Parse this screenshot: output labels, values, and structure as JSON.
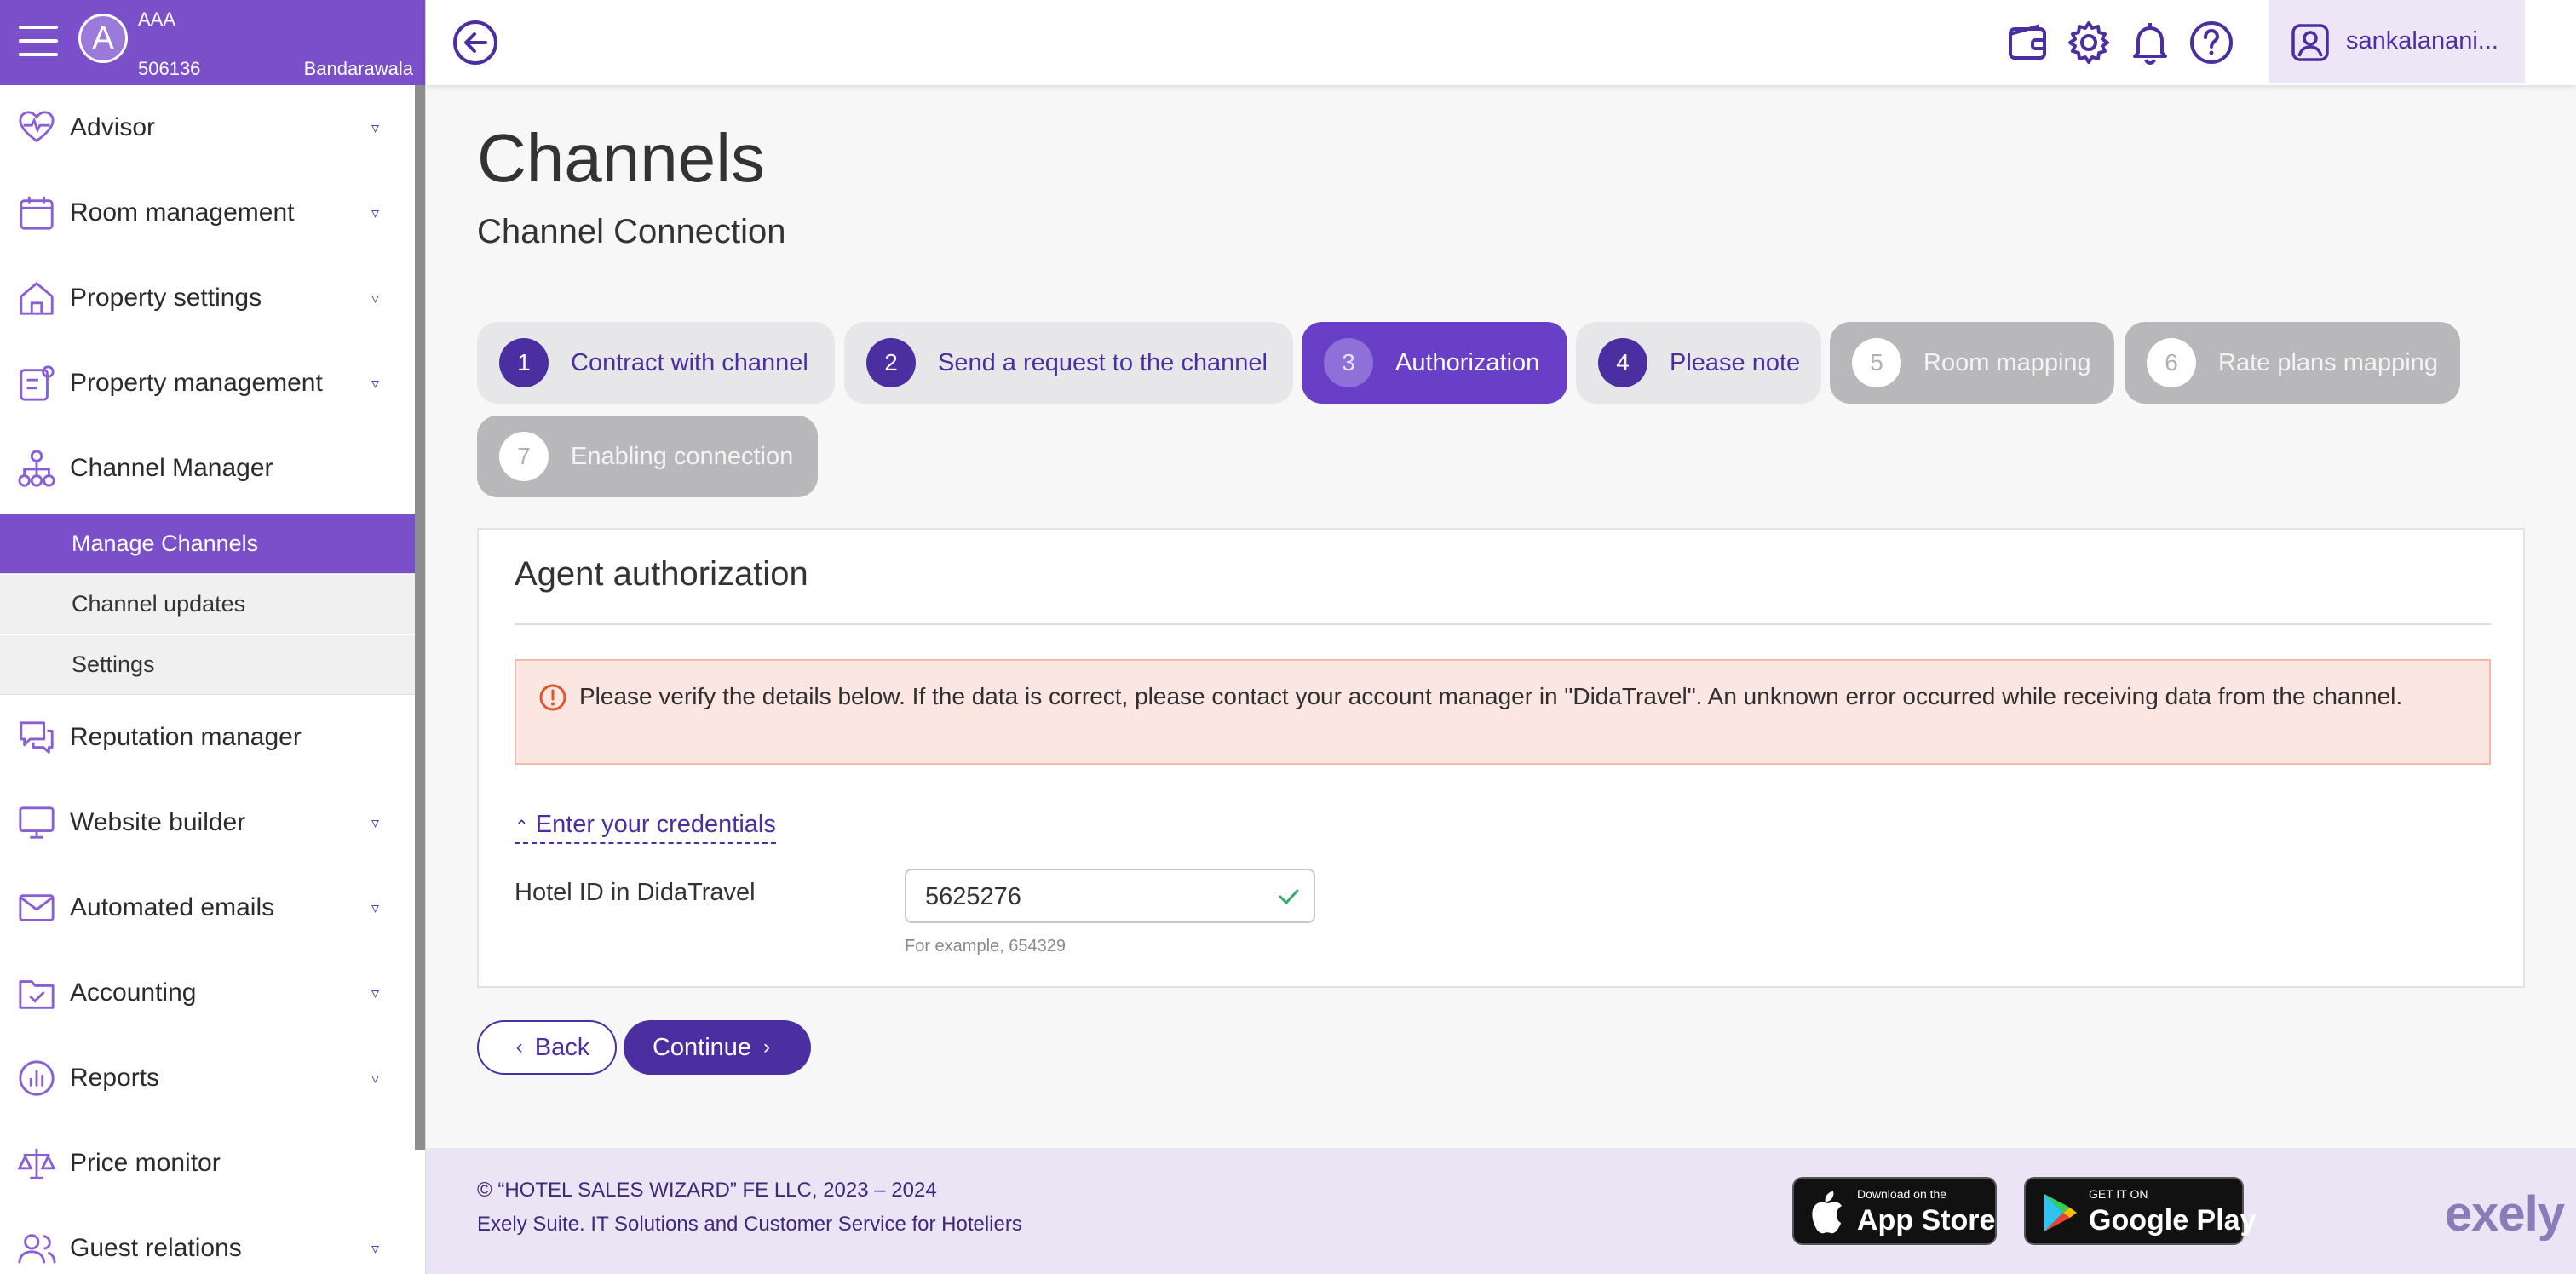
{
  "sidebar": {
    "org_initial": "A",
    "org_name": "AAA",
    "org_id": "506136",
    "location": "Bandarawala",
    "items": [
      {
        "label": "Advisor",
        "icon": "heart-pulse-icon"
      },
      {
        "label": "Room management",
        "icon": "calendar-icon"
      },
      {
        "label": "Property settings",
        "icon": "home-icon"
      },
      {
        "label": "Property management",
        "icon": "clipboard-icon"
      },
      {
        "label": "Channel Manager",
        "icon": "sitemap-icon"
      },
      {
        "label": "Reputation manager",
        "icon": "chat-icon"
      },
      {
        "label": "Website builder",
        "icon": "monitor-icon"
      },
      {
        "label": "Automated emails",
        "icon": "mail-icon"
      },
      {
        "label": "Accounting",
        "icon": "folder-check-icon"
      },
      {
        "label": "Reports",
        "icon": "bar-chart-icon"
      },
      {
        "label": "Price monitor",
        "icon": "scale-icon"
      },
      {
        "label": "Guest relations",
        "icon": "users-icon"
      }
    ],
    "sub_items": [
      {
        "label": "Manage Channels",
        "active": true
      },
      {
        "label": "Channel updates",
        "active": false
      },
      {
        "label": "Settings",
        "active": false
      }
    ]
  },
  "topbar": {
    "username": "sankalanani..."
  },
  "page": {
    "title": "Channels",
    "subtitle": "Channel Connection"
  },
  "steps": [
    {
      "num": "1",
      "label": "Contract with channel",
      "state": "done"
    },
    {
      "num": "2",
      "label": "Send a request to the channel",
      "state": "done"
    },
    {
      "num": "3",
      "label": "Authorization",
      "state": "active"
    },
    {
      "num": "4",
      "label": "Please note",
      "state": "done"
    },
    {
      "num": "5",
      "label": "Room mapping",
      "state": "disabled"
    },
    {
      "num": "6",
      "label": "Rate plans mapping",
      "state": "disabled"
    },
    {
      "num": "7",
      "label": "Enabling connection",
      "state": "disabled"
    }
  ],
  "card": {
    "title": "Agent authorization",
    "alert": "Please verify the details below. If the data is correct, please contact your account manager in \"DidaTravel\". An unknown error occurred while receiving data from the channel.",
    "credentials_toggle": "Enter your credentials",
    "field_label": "Hotel ID in DidaTravel",
    "field_value": "5625276",
    "field_hint": "For example, 654329"
  },
  "actions": {
    "back": "Back",
    "continue": "Continue"
  },
  "footer": {
    "copyright": "© “HOTEL SALES WIZARD” FE LLC, 2023 – 2024",
    "tagline": "Exely Suite. IT Solutions and Customer Service for Hoteliers",
    "appstore_small": "Download on the",
    "appstore_big": "App Store",
    "googleplay_small": "GET IT ON",
    "googleplay_big": "Google Play",
    "brand": "exely"
  },
  "colors": {
    "primary": "#4b2ea0",
    "sidebar_header": "#7b4fc9",
    "active_step": "#6a3fc7",
    "alert_bg": "#fbe6e1",
    "success": "#3aa86b"
  }
}
